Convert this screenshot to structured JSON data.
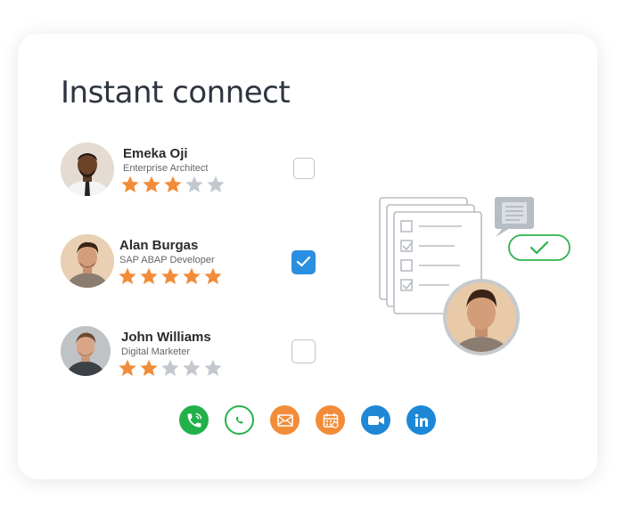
{
  "title": "Instant connect",
  "candidates": [
    {
      "name": "Emeka Oji",
      "role": "Enterprise Architect",
      "rating": 3,
      "max_rating": 5,
      "selected": false
    },
    {
      "name": "Alan Burgas",
      "role": "SAP ABAP Developer",
      "rating": 5,
      "max_rating": 5,
      "selected": true
    },
    {
      "name": "John Williams",
      "role": "Digital Marketer",
      "rating": 2,
      "max_rating": 5,
      "selected": false
    }
  ],
  "contact_icons": [
    "phone-icon",
    "whatsapp-icon",
    "email-icon",
    "calendar-icon",
    "video-call-icon",
    "linkedin-icon"
  ],
  "colors": {
    "star_filled": "#f28c38",
    "star_empty": "#c3c8ce",
    "checkbox_checked": "#2a8fe0",
    "approval_green": "#2db24a",
    "phone": "#22b04b",
    "whatsapp": "#25b34b",
    "email": "#f28c38",
    "calendar": "#f28c38",
    "video": "#1e88d6",
    "linkedin": "#1e88d6"
  }
}
